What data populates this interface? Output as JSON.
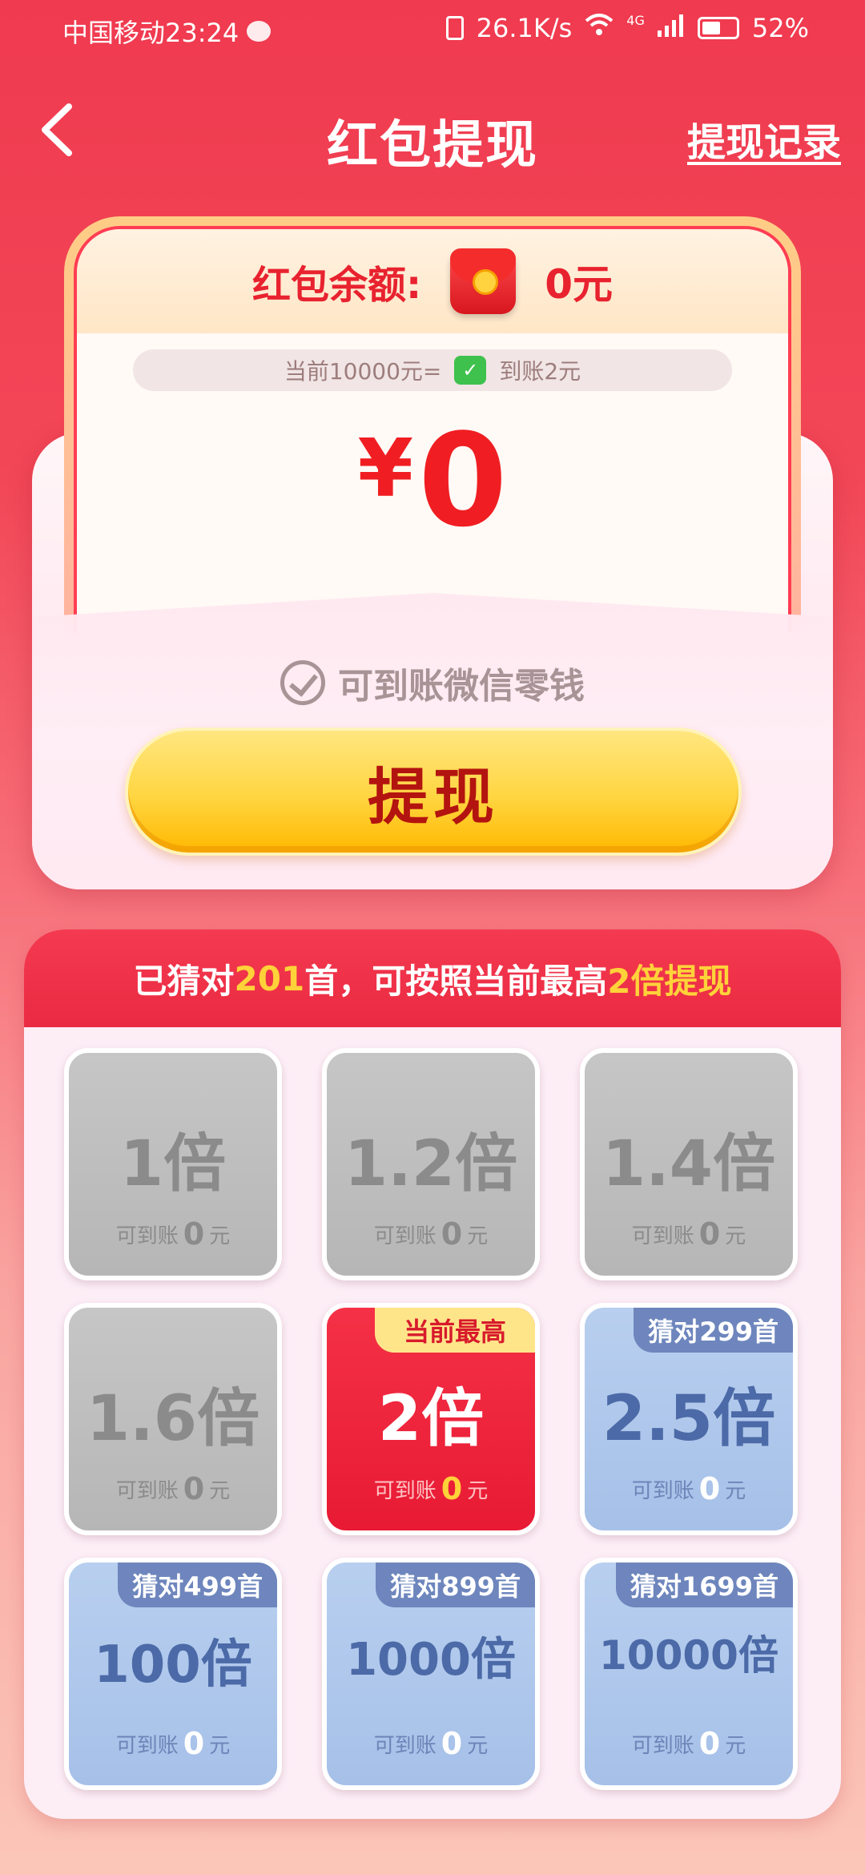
{
  "status_bar": {
    "carrier_time": "中国移动23:24",
    "net_speed": "26.1K/s",
    "network": "4G",
    "battery": "52%"
  },
  "header": {
    "title": "红包提现",
    "record_link": "提现记录"
  },
  "balance": {
    "label": "红包余额:",
    "amount": "0元",
    "rate_prefix": "当前10000元=",
    "rate_suffix": "到账2元",
    "big_symbol": "¥",
    "big_value": "0"
  },
  "envelope": {
    "check_text": "可到账微信零钱",
    "withdraw_button": "提现"
  },
  "panel": {
    "head_prefix": "已猜对",
    "head_count": "201",
    "head_middle": "首，可按照当前最高",
    "head_mult": "2倍提现",
    "cells": [
      {
        "mult": "1倍",
        "foot_label": "可到账",
        "amount": "0",
        "unit": "元",
        "style": "gray",
        "tag": ""
      },
      {
        "mult": "1.2倍",
        "foot_label": "可到账",
        "amount": "0",
        "unit": "元",
        "style": "gray",
        "tag": ""
      },
      {
        "mult": "1.4倍",
        "foot_label": "可到账",
        "amount": "0",
        "unit": "元",
        "style": "gray",
        "tag": ""
      },
      {
        "mult": "1.6倍",
        "foot_label": "可到账",
        "amount": "0",
        "unit": "元",
        "style": "gray",
        "tag": ""
      },
      {
        "mult": "2倍",
        "foot_label": "可到账",
        "amount": "0",
        "unit": "元",
        "style": "red",
        "tag": "当前最高"
      },
      {
        "mult": "2.5倍",
        "foot_label": "可到账",
        "amount": "0",
        "unit": "元",
        "style": "blue",
        "tag": "猜对299首"
      },
      {
        "mult": "100倍",
        "foot_label": "可到账",
        "amount": "0",
        "unit": "元",
        "style": "blue",
        "tag": "猜对499首"
      },
      {
        "mult": "1000倍",
        "foot_label": "可到账",
        "amount": "0",
        "unit": "元",
        "style": "blue",
        "tag": "猜对899首"
      },
      {
        "mult": "10000倍",
        "foot_label": "可到账",
        "amount": "0",
        "unit": "元",
        "style": "blue",
        "tag": "猜对1699首"
      }
    ]
  },
  "icons": {
    "back": "chevron-left-icon",
    "hongbao": "red-envelope-icon",
    "wechat_pay": "wechat-pay-icon",
    "check": "check-circle-icon"
  },
  "colors": {
    "primary_red": "#f03a4f",
    "amount_red": "#f01e22",
    "button_yellow": "#ffd540",
    "highlight_yellow": "#ffd23a",
    "locked_gray": "#c0c0c0",
    "future_blue": "#b3cbee"
  }
}
